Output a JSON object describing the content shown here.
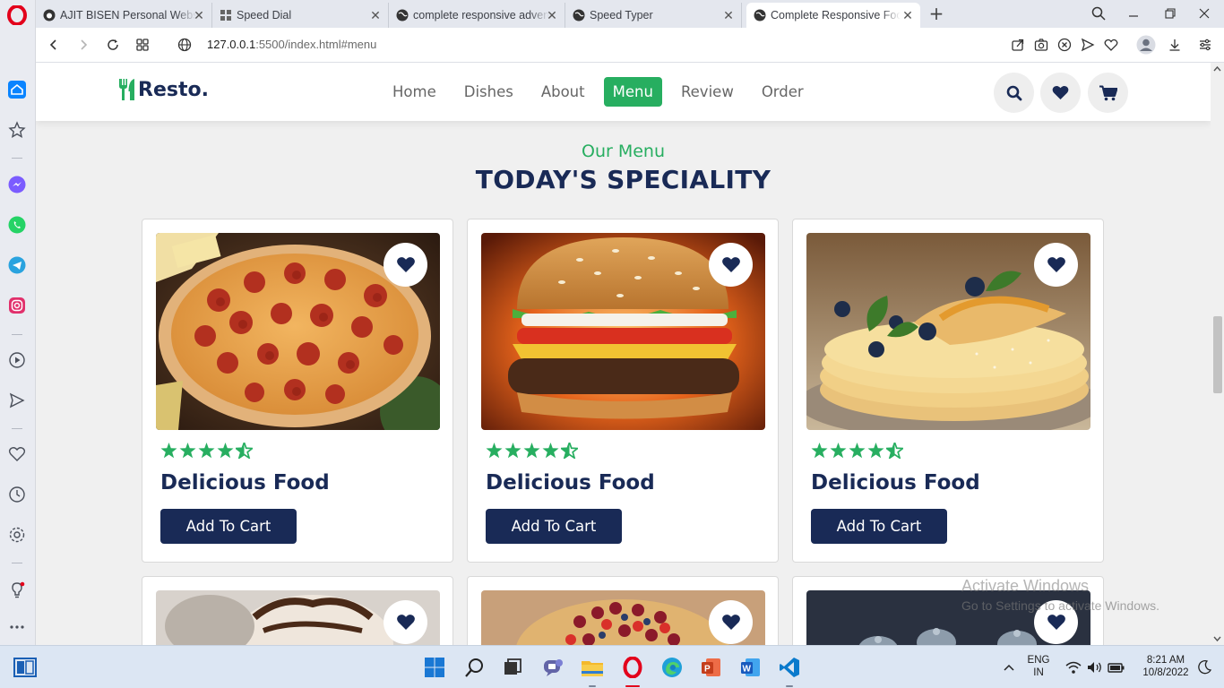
{
  "browser": {
    "tabs": [
      {
        "title": "AJIT BISEN Personal Website",
        "favicon": "github-icon"
      },
      {
        "title": "Speed Dial",
        "favicon": "speed-dial-icon"
      },
      {
        "title": "complete responsive advertisement",
        "favicon": "globe-icon"
      },
      {
        "title": "Speed Typer",
        "favicon": "globe-icon"
      },
      {
        "title": "Complete Responsive Food Website",
        "favicon": "globe-icon"
      }
    ],
    "active_tab_index": 4,
    "url_host": "127.0.0.1",
    "url_rest": ":5500/index.html#menu"
  },
  "site": {
    "brand": "Resto.",
    "nav": [
      "Home",
      "Dishes",
      "About",
      "Menu",
      "Review",
      "Order"
    ],
    "active_nav": "Menu",
    "sub_heading": "Our Menu",
    "heading": "TODAY'S SPECIALITY",
    "cards": [
      {
        "image": "pizza",
        "title": "Delicious Food",
        "button": "Add To Cart",
        "rating": 4.5
      },
      {
        "image": "burger",
        "title": "Delicious Food",
        "button": "Add To Cart",
        "rating": 4.5
      },
      {
        "image": "pancakes",
        "title": "Delicious Food",
        "button": "Add To Cart",
        "rating": 4.5
      },
      {
        "image": "ice-cream",
        "title": "",
        "button": "",
        "rating": null
      },
      {
        "image": "berry-tart",
        "title": "",
        "button": "",
        "rating": null
      },
      {
        "image": "cupcakes",
        "title": "",
        "button": "",
        "rating": null
      }
    ]
  },
  "watermark": {
    "line1": "Activate Windows",
    "line2": "Go to Settings to activate Windows."
  },
  "taskbar": {
    "lang": "ENG",
    "region": "IN",
    "time": "8:21 AM",
    "date": "10/8/2022"
  },
  "colors": {
    "accent_green": "#27ae60",
    "navy": "#192a56",
    "opera_red": "#e3001b"
  }
}
